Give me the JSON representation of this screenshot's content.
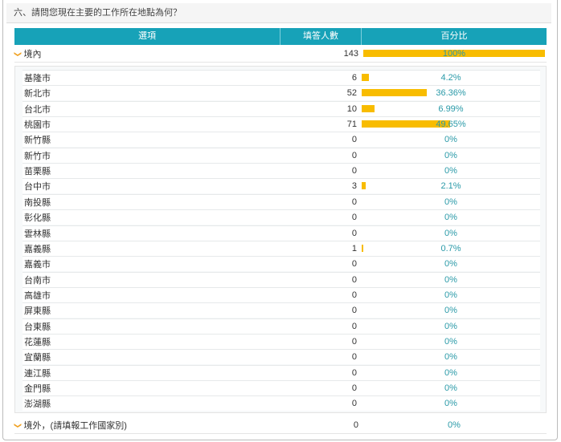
{
  "question": "六、請問您現在主要的工作所在地點為何？",
  "headers": {
    "option": "選項",
    "count": "填答人數",
    "percent": "百分比"
  },
  "bar_color": "#f8bc00",
  "groups": [
    {
      "label": "境內",
      "count": "143",
      "percent": "100%",
      "pct_value": 100
    },
    {
      "label": "境外，(請填報工作國家別)",
      "count": "0",
      "percent": "0%",
      "pct_value": 0
    }
  ],
  "rows": [
    {
      "label": "基隆市",
      "count": "6",
      "percent": "4.2%",
      "pct_value": 4.2
    },
    {
      "label": "新北市",
      "count": "52",
      "percent": "36.36%",
      "pct_value": 36.36
    },
    {
      "label": "台北市",
      "count": "10",
      "percent": "6.99%",
      "pct_value": 6.99
    },
    {
      "label": "桃園市",
      "count": "71",
      "percent": "49.65%",
      "pct_value": 49.65
    },
    {
      "label": "新竹縣",
      "count": "0",
      "percent": "0%",
      "pct_value": 0
    },
    {
      "label": "新竹市",
      "count": "0",
      "percent": "0%",
      "pct_value": 0
    },
    {
      "label": "苗栗縣",
      "count": "0",
      "percent": "0%",
      "pct_value": 0
    },
    {
      "label": "台中市",
      "count": "3",
      "percent": "2.1%",
      "pct_value": 2.1
    },
    {
      "label": "南投縣",
      "count": "0",
      "percent": "0%",
      "pct_value": 0
    },
    {
      "label": "彰化縣",
      "count": "0",
      "percent": "0%",
      "pct_value": 0
    },
    {
      "label": "雲林縣",
      "count": "0",
      "percent": "0%",
      "pct_value": 0
    },
    {
      "label": "嘉義縣",
      "count": "1",
      "percent": "0.7%",
      "pct_value": 0.7
    },
    {
      "label": "嘉義市",
      "count": "0",
      "percent": "0%",
      "pct_value": 0
    },
    {
      "label": "台南市",
      "count": "0",
      "percent": "0%",
      "pct_value": 0
    },
    {
      "label": "高雄市",
      "count": "0",
      "percent": "0%",
      "pct_value": 0
    },
    {
      "label": "屏東縣",
      "count": "0",
      "percent": "0%",
      "pct_value": 0
    },
    {
      "label": "台東縣",
      "count": "0",
      "percent": "0%",
      "pct_value": 0
    },
    {
      "label": "花蓮縣",
      "count": "0",
      "percent": "0%",
      "pct_value": 0
    },
    {
      "label": "宜蘭縣",
      "count": "0",
      "percent": "0%",
      "pct_value": 0
    },
    {
      "label": "連江縣",
      "count": "0",
      "percent": "0%",
      "pct_value": 0
    },
    {
      "label": "金門縣",
      "count": "0",
      "percent": "0%",
      "pct_value": 0
    },
    {
      "label": "澎湖縣",
      "count": "0",
      "percent": "0%",
      "pct_value": 0
    }
  ]
}
